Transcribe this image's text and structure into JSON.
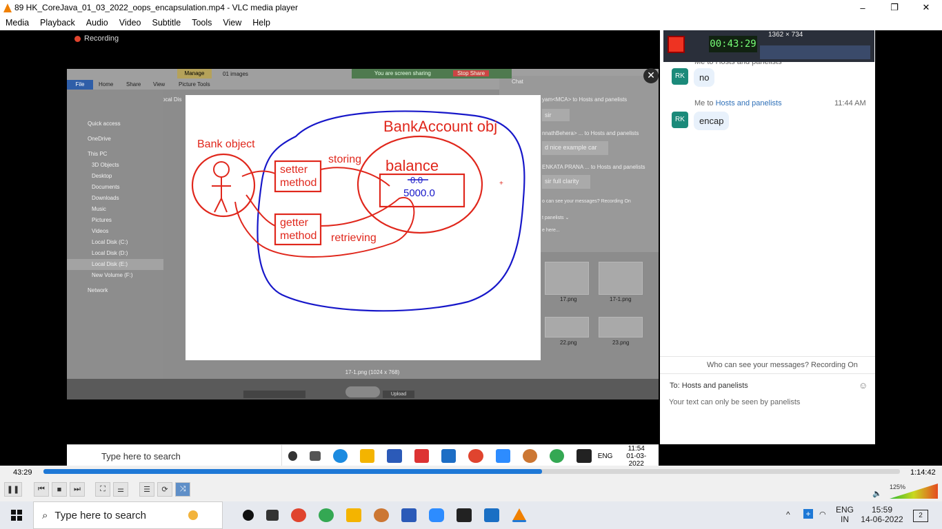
{
  "window": {
    "title": "89 HK_CoreJava_01_03_2022_oops_encapsulation.mp4 - VLC media player",
    "controls": [
      "–",
      "❐",
      "✕"
    ]
  },
  "menu": [
    "Media",
    "Playback",
    "Audio",
    "Video",
    "Subtitle",
    "Tools",
    "View",
    "Help"
  ],
  "video": {
    "zoom_recording": "Recording",
    "explorer": {
      "tabs": [
        "File",
        "Home",
        "Share",
        "View"
      ],
      "manage": "Manage",
      "picture_tools": "Picture Tools",
      "images_count": "01 images",
      "path": "This PC › Local Dis",
      "sidebar": [
        "Quick access",
        "OneDrive",
        "This PC",
        "3D Objects",
        "Desktop",
        "Documents",
        "Downloads",
        "Music",
        "Pictures",
        "Videos",
        "Local Disk (C:)",
        "Local Disk (D:)",
        "Local Disk (E:)",
        "New Volume (F:)",
        "Network"
      ],
      "thumbs": [
        "17.png",
        "17-1.png",
        "22.png",
        "23.png"
      ],
      "caption": "17-1.png (1024 x 768)",
      "upload": "Upload"
    },
    "share_bar": {
      "label": "You are screen sharing",
      "stop": "Stop Share"
    },
    "background_chat": {
      "title": "Chat",
      "lines": [
        "yam<MCA> to Hosts and panelists",
        "sir",
        "nnathBehera>  ...  to Hosts and panelists",
        "d nice example car",
        "ENKATA PRANA ... to Hosts and panelists",
        "sir full clarity",
        "o can see your messages? Recording On",
        "t panelists ⌄",
        "e here..."
      ]
    },
    "slide": {
      "title": "BankAccount obj",
      "bank_object": "Bank object",
      "setter": [
        "setter",
        "method"
      ],
      "getter": [
        "getter",
        "method"
      ],
      "storing": "storing",
      "retrieving": "retrieving",
      "balance": "balance",
      "old_value": "0.0",
      "new_value": "5000.0"
    },
    "inner_taskbar": {
      "search": "Type here to search",
      "lang": "ENG",
      "time": "11:54",
      "date": "01-03-2022"
    },
    "recorder": {
      "resolution": "1362 × 734",
      "timer": "00:43:29"
    },
    "chat": {
      "partial_meta": "Me to Hosts and panelists",
      "messages": [
        {
          "avatar": "RK",
          "text": "no"
        },
        {
          "meta_prefix": "Me to ",
          "meta_to": "Hosts and panelists",
          "time": "11:44 AM",
          "avatar": "RK",
          "text": "encap"
        }
      ],
      "footer_notice": "Who can see your messages? Recording On",
      "to_label": "To:",
      "to_value": "Hosts and panelists",
      "input_placeholder": "Your text can only be seen by panelists"
    }
  },
  "player": {
    "elapsed": "43:29",
    "total": "1:14:42",
    "progress": 0.582,
    "volume": "125%"
  },
  "taskbar": {
    "search": "Type here to search",
    "lang_top": "ENG",
    "lang_bottom": "IN",
    "time": "15:59",
    "date": "14-06-2022",
    "notifications": "2"
  }
}
